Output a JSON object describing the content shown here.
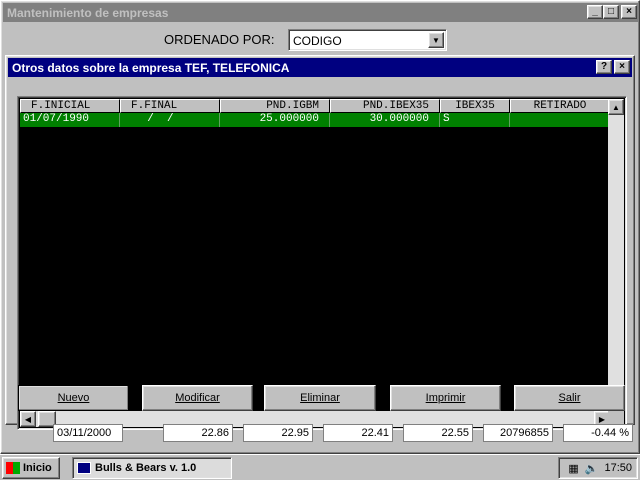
{
  "main_window": {
    "title": "Mantenimiento de empresas",
    "controls": {
      "minimize": "_",
      "maximize": "□",
      "close": "×"
    }
  },
  "order": {
    "label": "ORDENADO POR:",
    "value": "CODIGO"
  },
  "dialog": {
    "title": "Otros datos sobre la empresa TEF, TELEFONICA",
    "controls": {
      "help": "?",
      "close": "×"
    }
  },
  "grid": {
    "columns": [
      "F.INICIAL",
      "F.FINAL",
      "PND.IGBM",
      "PND.IBEX35",
      "IBEX35",
      "RETIRADO"
    ],
    "rows": [
      [
        "01/07/1990",
        "  /  /",
        "25.000000",
        "30.000000",
        "S",
        ""
      ]
    ]
  },
  "buttons": {
    "nuevo": "Nuevo",
    "modificar": "Modificar",
    "eliminar": "Eliminar",
    "imprimir": "Imprimir",
    "salir": "Salir"
  },
  "background_row": [
    "03/11/2000",
    "22.86",
    "22.95",
    "22.41",
    "22.55",
    "20796855",
    "-0.44 %"
  ],
  "taskbar": {
    "start_label": "Inicio",
    "task_label": "Bulls & Bears v. 1.0",
    "clock": "17:50"
  }
}
